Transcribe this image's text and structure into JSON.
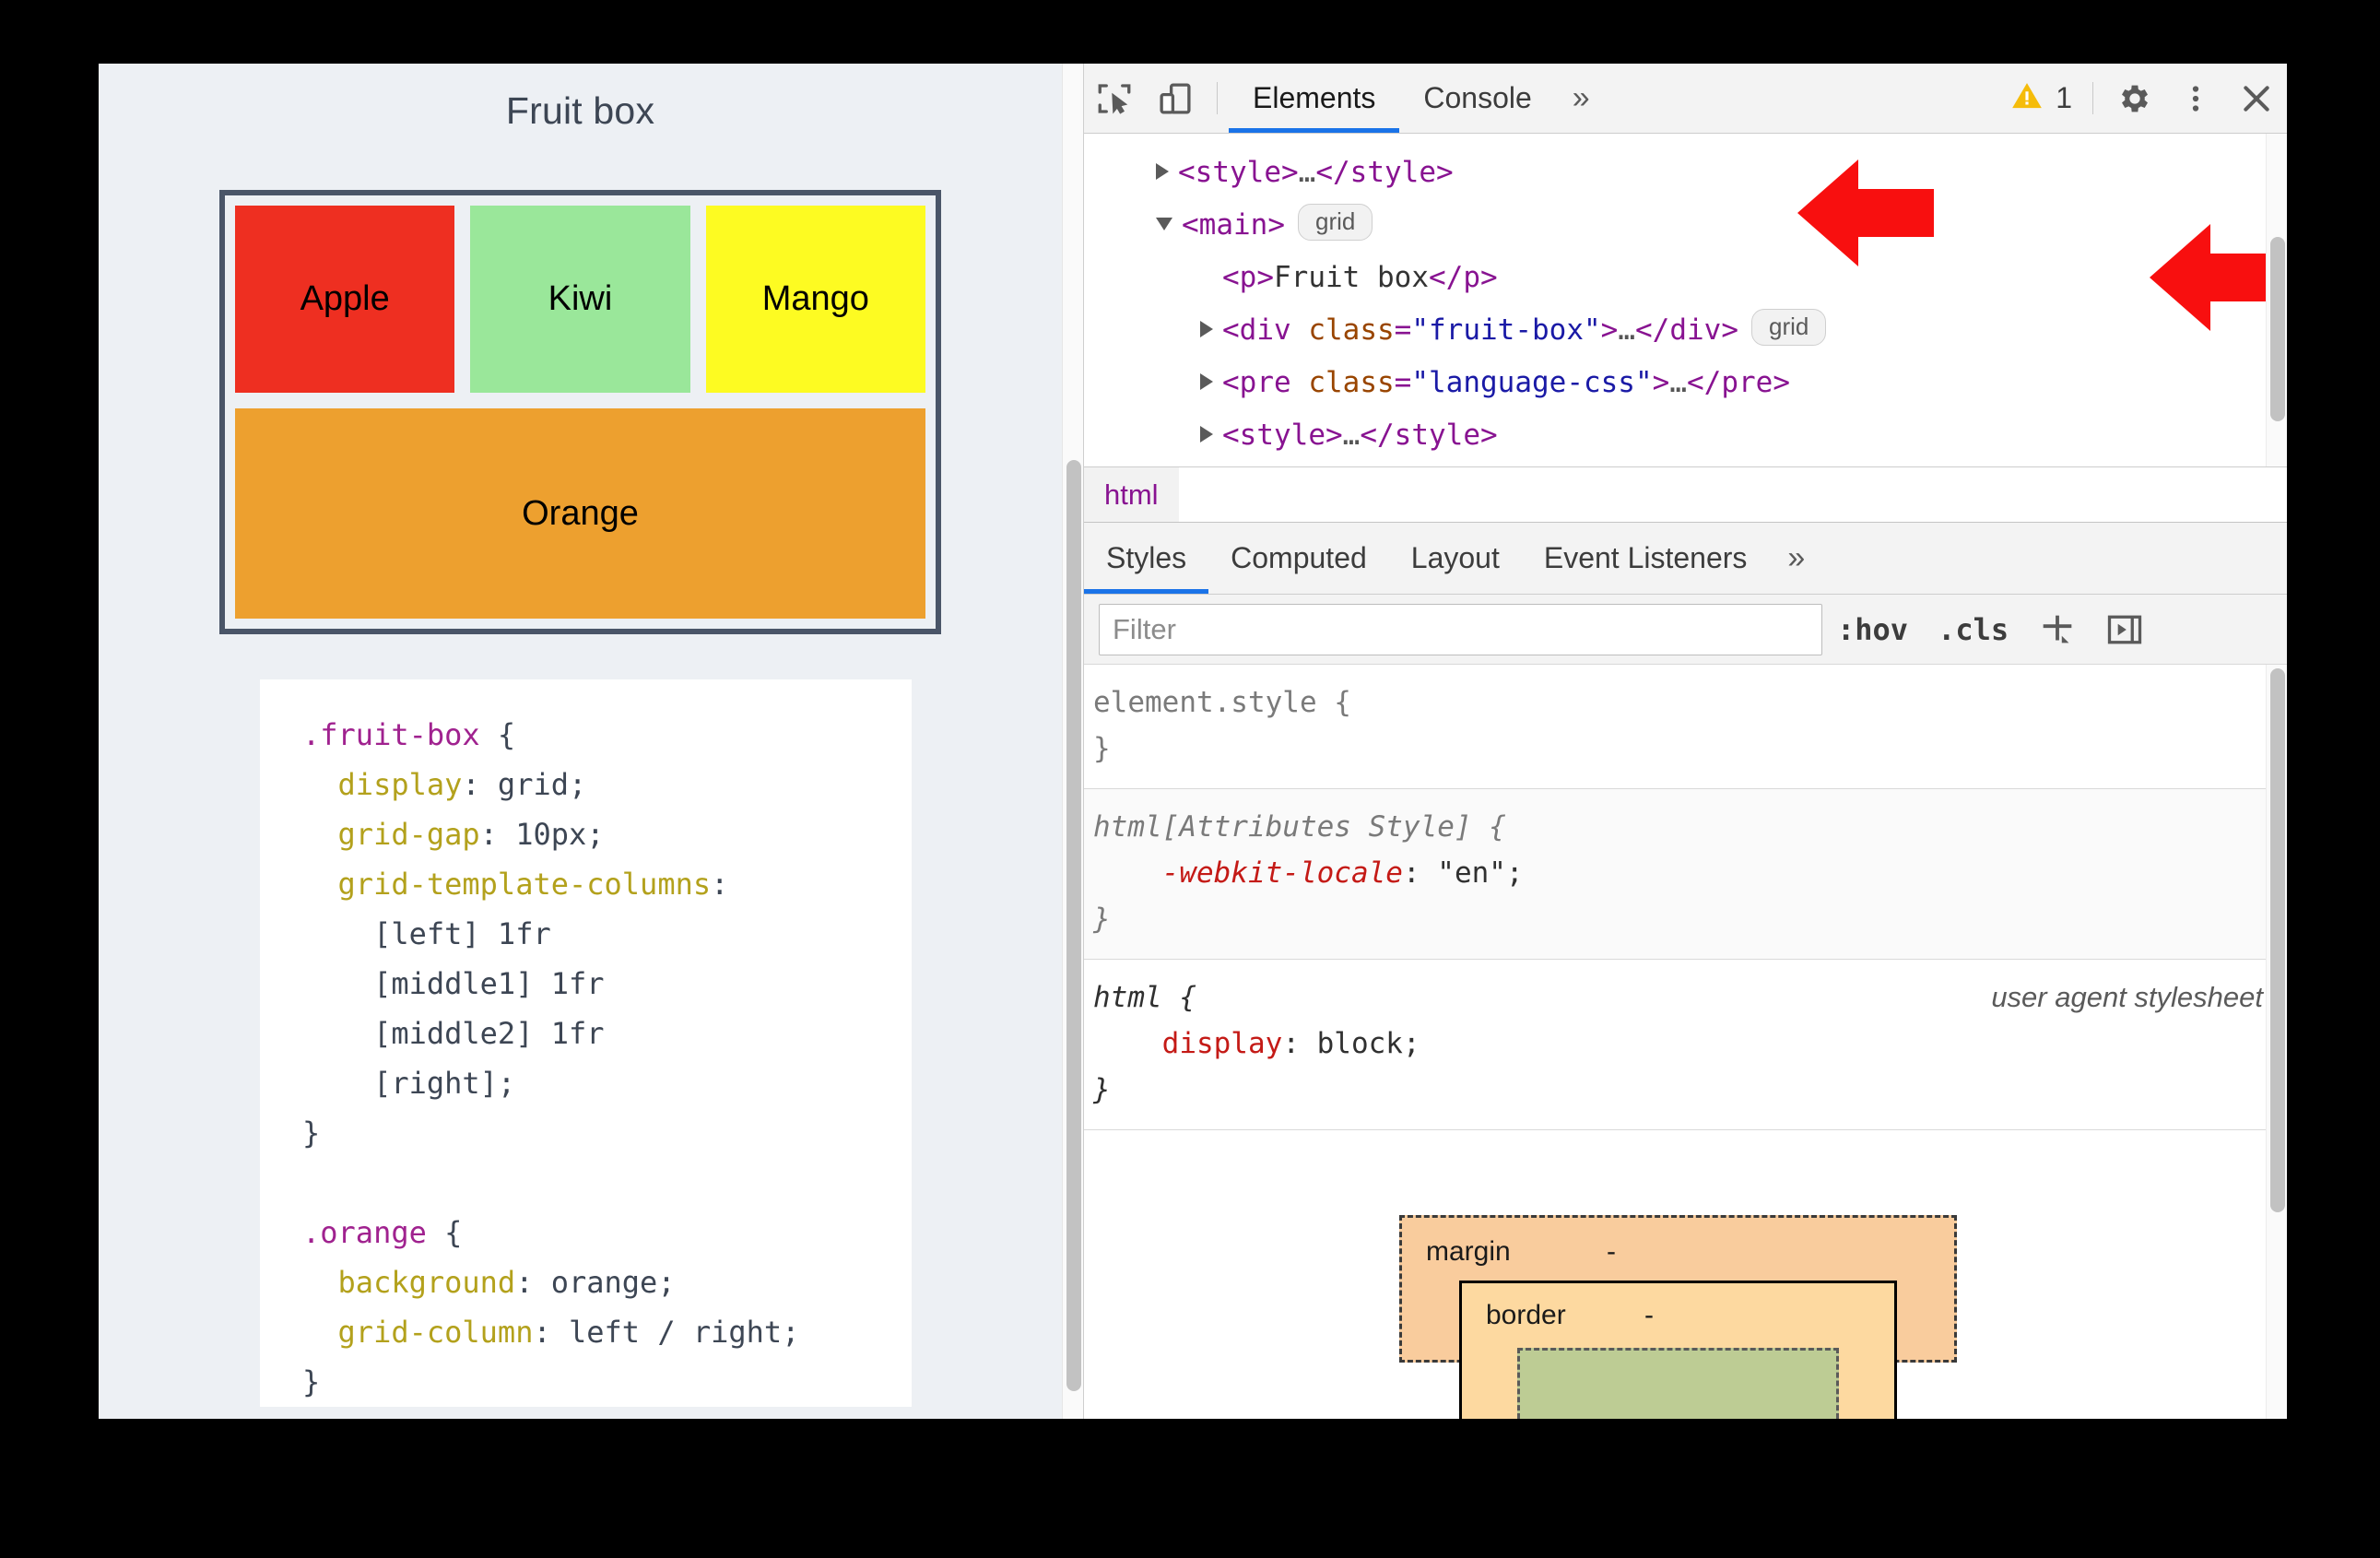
{
  "page": {
    "title": "Fruit box",
    "fruits": [
      {
        "name": "Apple",
        "color": "#ee2f21"
      },
      {
        "name": "Kiwi",
        "color": "#9ae79a"
      },
      {
        "name": "Mango",
        "color": "#fdfb22"
      },
      {
        "name": "Orange",
        "color": "#eda02f"
      }
    ],
    "code": {
      "rule1": {
        "selector": ".fruit-box",
        "open": " {",
        "lines": [
          {
            "prop": "display",
            "colon": ": ",
            "value": "grid;"
          },
          {
            "prop": "grid-gap",
            "colon": ": ",
            "value": "10px;"
          },
          {
            "prop": "grid-template-columns",
            "colon": ":",
            "value": ""
          }
        ],
        "continuation": [
          "[left] 1fr",
          "[middle1] 1fr",
          "[middle2] 1fr",
          "[right];"
        ],
        "close": "}"
      },
      "rule2": {
        "selector": ".orange",
        "open": " {",
        "lines": [
          {
            "prop": "background",
            "colon": ": ",
            "value": "orange;"
          },
          {
            "prop": "grid-column",
            "colon": ": ",
            "value": "left / right;"
          }
        ],
        "close": "}"
      }
    }
  },
  "devtools": {
    "toolbar": {
      "inspect_icon": "inspect-element-icon",
      "device_icon": "device-toolbar-icon",
      "tabs": [
        {
          "label": "Elements",
          "active": true
        },
        {
          "label": "Console",
          "active": false
        }
      ],
      "more_tabs": "»",
      "warning_icon": "warning-triangle-icon",
      "warning_count": "1",
      "settings_icon": "gear-icon",
      "menu_icon": "kebab-menu-icon",
      "close_icon": "close-icon"
    },
    "dom_tree": {
      "rows": [
        {
          "indent": 0,
          "twisty": "right",
          "segments": [
            {
              "t": "punc",
              "v": "<"
            },
            {
              "t": "tag",
              "v": "style"
            },
            {
              "t": "punc",
              "v": ">"
            },
            {
              "t": "ell",
              "v": "…"
            },
            {
              "t": "punc",
              "v": "</"
            },
            {
              "t": "tag",
              "v": "style"
            },
            {
              "t": "punc",
              "v": ">"
            }
          ],
          "badge": null
        },
        {
          "indent": 0,
          "twisty": "down",
          "segments": [
            {
              "t": "punc",
              "v": "<"
            },
            {
              "t": "tag",
              "v": "main"
            },
            {
              "t": "punc",
              "v": ">"
            }
          ],
          "badge": "grid"
        },
        {
          "indent": 1,
          "twisty": "none",
          "segments": [
            {
              "t": "punc",
              "v": "<"
            },
            {
              "t": "tag",
              "v": "p"
            },
            {
              "t": "punc",
              "v": ">"
            },
            {
              "t": "txt",
              "v": "Fruit box"
            },
            {
              "t": "punc",
              "v": "</"
            },
            {
              "t": "tag",
              "v": "p"
            },
            {
              "t": "punc",
              "v": ">"
            }
          ],
          "badge": null
        },
        {
          "indent": 1,
          "twisty": "right",
          "segments": [
            {
              "t": "punc",
              "v": "<"
            },
            {
              "t": "tag",
              "v": "div"
            },
            {
              "t": "txt",
              "v": " "
            },
            {
              "t": "attr",
              "v": "class"
            },
            {
              "t": "punc",
              "v": "="
            },
            {
              "t": "aval",
              "v": "\"fruit-box\""
            },
            {
              "t": "punc",
              "v": ">"
            },
            {
              "t": "ell",
              "v": "…"
            },
            {
              "t": "punc",
              "v": "</"
            },
            {
              "t": "tag",
              "v": "div"
            },
            {
              "t": "punc",
              "v": ">"
            }
          ],
          "badge": "grid"
        },
        {
          "indent": 1,
          "twisty": "right",
          "segments": [
            {
              "t": "punc",
              "v": "<"
            },
            {
              "t": "tag",
              "v": "pre"
            },
            {
              "t": "txt",
              "v": " "
            },
            {
              "t": "attr",
              "v": "class"
            },
            {
              "t": "punc",
              "v": "="
            },
            {
              "t": "aval",
              "v": "\"language-css\""
            },
            {
              "t": "punc",
              "v": ">"
            },
            {
              "t": "ell",
              "v": "…"
            },
            {
              "t": "punc",
              "v": "</"
            },
            {
              "t": "tag",
              "v": "pre"
            },
            {
              "t": "punc",
              "v": ">"
            }
          ],
          "badge": null
        },
        {
          "indent": 1,
          "twisty": "right",
          "segments": [
            {
              "t": "punc",
              "v": "<"
            },
            {
              "t": "tag",
              "v": "style"
            },
            {
              "t": "punc",
              "v": ">"
            },
            {
              "t": "ell",
              "v": "…"
            },
            {
              "t": "punc",
              "v": "</"
            },
            {
              "t": "tag",
              "v": "style"
            },
            {
              "t": "punc",
              "v": ">"
            }
          ],
          "badge": null
        }
      ],
      "annotation_arrows": [
        {
          "name": "arrow-pointing-main-grid-badge",
          "color": "#f80f0f"
        },
        {
          "name": "arrow-pointing-fruitbox-grid-badge",
          "color": "#f80f0f"
        }
      ]
    },
    "breadcrumb": {
      "items": [
        "html"
      ]
    },
    "sidebar_tabs": [
      {
        "label": "Styles",
        "active": true
      },
      {
        "label": "Computed",
        "active": false
      },
      {
        "label": "Layout",
        "active": false
      },
      {
        "label": "Event Listeners",
        "active": false
      }
    ],
    "sidebar_more": "»",
    "styles_toolbar": {
      "filter_placeholder": "Filter",
      "filter_value": "",
      "hov_label": ":hov",
      "cls_label": ".cls",
      "new_rule_icon": "plus-icon",
      "sidebar_toggle_icon": "toggle-sidebar-icon"
    },
    "style_rules": [
      {
        "selector": "element.style",
        "open": " {",
        "origin": "",
        "declarations": [],
        "close": "}"
      },
      {
        "selector": "html[Attributes Style]",
        "open": " {",
        "origin": "",
        "declarations": [
          {
            "prop": "-webkit-locale",
            "colon": ": ",
            "value": "\"en\";"
          }
        ],
        "close": "}"
      },
      {
        "selector": "html",
        "open": " {",
        "origin": "user agent stylesheet",
        "declarations": [
          {
            "prop": "display",
            "colon": ": ",
            "value": "block;"
          }
        ],
        "close": "}"
      }
    ],
    "box_model": {
      "margin_label": "margin",
      "margin_value": "-",
      "border_label": "border",
      "border_value": "-",
      "colors": {
        "margin": "#f9cc9d",
        "border": "#fdd9a0",
        "padding": "#bdcc94"
      }
    }
  }
}
